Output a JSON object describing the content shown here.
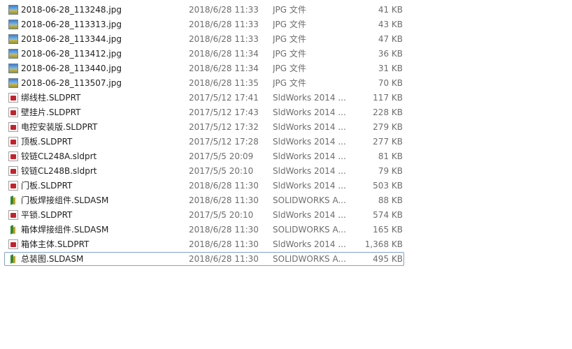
{
  "files": [
    {
      "name": "2018-06-28_113248.jpg",
      "date": "2018/6/28 11:33",
      "type": "JPG 文件",
      "size": "41 KB",
      "icon": "jpg"
    },
    {
      "name": "2018-06-28_113313.jpg",
      "date": "2018/6/28 11:33",
      "type": "JPG 文件",
      "size": "43 KB",
      "icon": "jpg"
    },
    {
      "name": "2018-06-28_113344.jpg",
      "date": "2018/6/28 11:33",
      "type": "JPG 文件",
      "size": "47 KB",
      "icon": "jpg"
    },
    {
      "name": "2018-06-28_113412.jpg",
      "date": "2018/6/28 11:34",
      "type": "JPG 文件",
      "size": "36 KB",
      "icon": "jpg"
    },
    {
      "name": "2018-06-28_113440.jpg",
      "date": "2018/6/28 11:34",
      "type": "JPG 文件",
      "size": "31 KB",
      "icon": "jpg"
    },
    {
      "name": "2018-06-28_113507.jpg",
      "date": "2018/6/28 11:35",
      "type": "JPG 文件",
      "size": "70 KB",
      "icon": "jpg"
    },
    {
      "name": "绑线柱.SLDPRT",
      "date": "2017/5/12 17:41",
      "type": "SldWorks 2014 ...",
      "size": "117 KB",
      "icon": "prt"
    },
    {
      "name": "壁挂片.SLDPRT",
      "date": "2017/5/12 17:43",
      "type": "SldWorks 2014 ...",
      "size": "228 KB",
      "icon": "prt"
    },
    {
      "name": "电控安装版.SLDPRT",
      "date": "2017/5/12 17:32",
      "type": "SldWorks 2014 ...",
      "size": "279 KB",
      "icon": "prt"
    },
    {
      "name": "顶板.SLDPRT",
      "date": "2017/5/12 17:28",
      "type": "SldWorks 2014 ...",
      "size": "277 KB",
      "icon": "prt"
    },
    {
      "name": "铰链CL248A.sldprt",
      "date": "2017/5/5 20:09",
      "type": "SldWorks 2014 ...",
      "size": "81 KB",
      "icon": "prt"
    },
    {
      "name": "铰链CL248B.sldprt",
      "date": "2017/5/5 20:10",
      "type": "SldWorks 2014 ...",
      "size": "79 KB",
      "icon": "prt"
    },
    {
      "name": "门板.SLDPRT",
      "date": "2018/6/28 11:30",
      "type": "SldWorks 2014 ...",
      "size": "503 KB",
      "icon": "prt"
    },
    {
      "name": "门板焊接组件.SLDASM",
      "date": "2018/6/28 11:30",
      "type": "SOLIDWORKS A...",
      "size": "88 KB",
      "icon": "asm"
    },
    {
      "name": "平锁.SLDPRT",
      "date": "2017/5/5 20:10",
      "type": "SldWorks 2014 ...",
      "size": "574 KB",
      "icon": "prt"
    },
    {
      "name": "箱体焊接组件.SLDASM",
      "date": "2018/6/28 11:30",
      "type": "SOLIDWORKS A...",
      "size": "165 KB",
      "icon": "asm"
    },
    {
      "name": "箱体主体.SLDPRT",
      "date": "2018/6/28 11:30",
      "type": "SldWorks 2014 ...",
      "size": "1,368 KB",
      "icon": "prt"
    },
    {
      "name": "总装图.SLDASM",
      "date": "2018/6/28 11:30",
      "type": "SOLIDWORKS A...",
      "size": "495 KB",
      "icon": "asm",
      "selected": true
    }
  ]
}
